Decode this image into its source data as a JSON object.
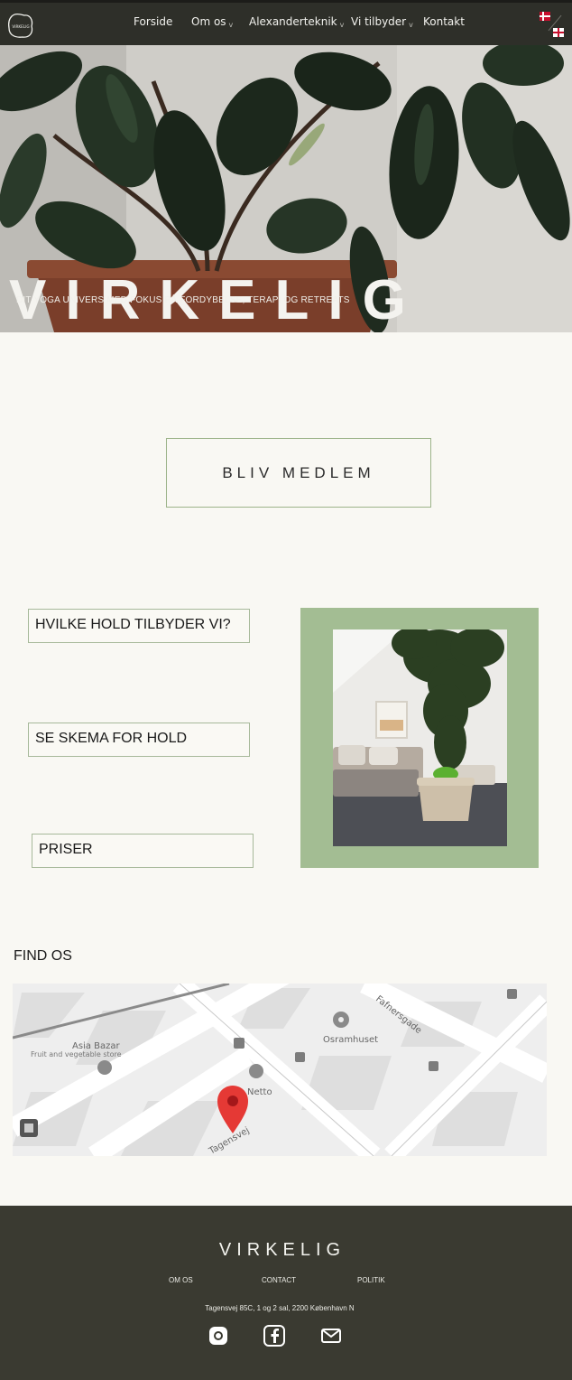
{
  "nav": {
    "logo_text": "VIRKELIG",
    "items": [
      {
        "label": "Forside",
        "dropdown": false
      },
      {
        "label": "Om os",
        "dropdown": true
      },
      {
        "label": "Alexanderteknik",
        "dropdown": true
      },
      {
        "label": "Vi tilbyder",
        "dropdown": true
      },
      {
        "label": "Kontakt",
        "dropdown": false
      }
    ],
    "dropdown_glyph": "v",
    "languages": [
      "da",
      "en"
    ]
  },
  "hero": {
    "title": "VIRKELIG",
    "subtitle": "DIT YOGA UNIVERS MED FOKUS PÅ FORDYBELSE, TERAPI OG RETREATS"
  },
  "cta": {
    "label": "BLIV MEDLEM"
  },
  "links": {
    "classes": "HVILKE HOLD TILBYDER VI?",
    "schedule": "SE SKEMA FOR HOLD",
    "prices": "PRISER"
  },
  "find_us": {
    "heading": "FIND OS",
    "map": {
      "labels": {
        "asia_bazar": "Asia Bazar",
        "asia_bazar_sub": "Fruit and vegetable store",
        "osramhuset": "Osramhuset",
        "netto": "Netto",
        "fafnersgade": "Fafnersgade",
        "tagensvej": "Tagensvej"
      }
    }
  },
  "footer": {
    "brand": "VIRKELIG",
    "links": [
      "OM OS",
      "CONTACT",
      "POLITIK"
    ],
    "address": "Tagensvej 85C, 1 og 2 sal, 2200 København N",
    "social_icons": [
      "instagram-icon",
      "facebook-icon",
      "mail-icon"
    ]
  },
  "colors": {
    "nav_bg": "#2e2f29",
    "page_bg": "#f9f8f3",
    "accent_green": "#a3bd93",
    "button_border": "#a7b99a",
    "footer_bg": "#3a3a31",
    "map_pin": "#e53935"
  }
}
